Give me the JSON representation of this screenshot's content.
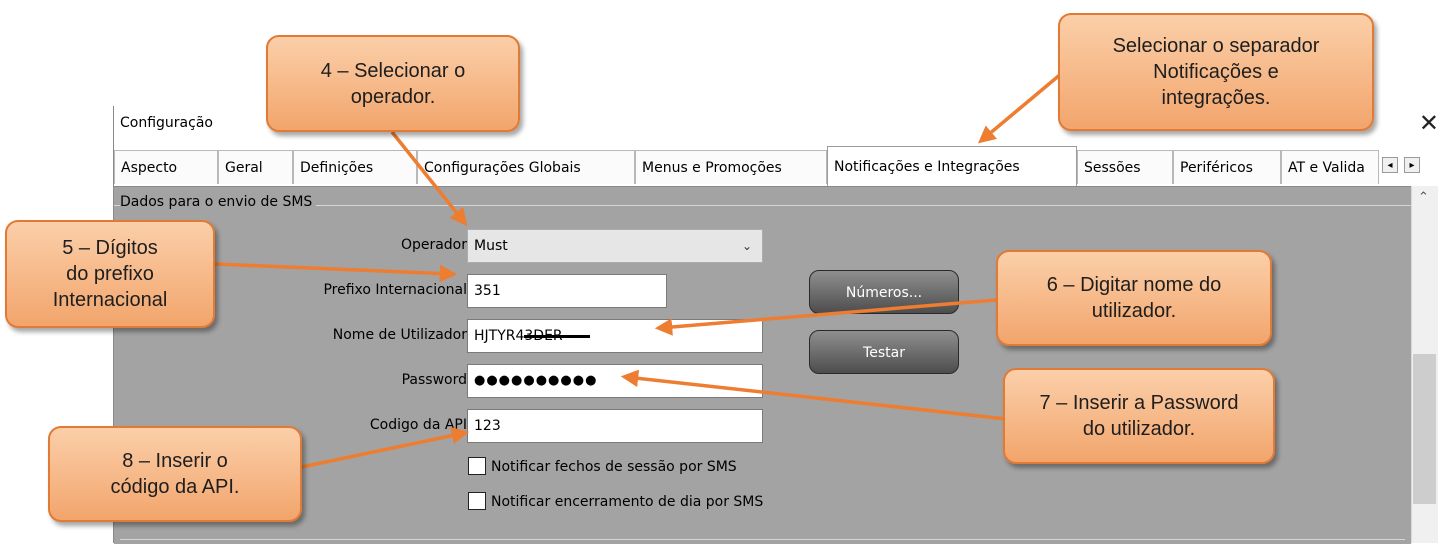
{
  "window": {
    "title": "Configuração",
    "close_glyph": "✕"
  },
  "tabs": [
    {
      "label": "Aspecto"
    },
    {
      "label": "Geral"
    },
    {
      "label": "Definições"
    },
    {
      "label": "Configurações Globais"
    },
    {
      "label": "Menus e Promoções"
    },
    {
      "label": "Notificações e Integrações",
      "active": true
    },
    {
      "label": "Sessões"
    },
    {
      "label": "Periféricos"
    },
    {
      "label": "AT e Valida"
    }
  ],
  "tab_scroll": {
    "left": "◂",
    "right": "▸"
  },
  "group": {
    "title": "Dados para o envio de SMS"
  },
  "form": {
    "operator_label": "Operador",
    "operator_value": "Must",
    "prefix_label": "Prefixo Internacional",
    "prefix_value": "351",
    "username_label": "Nome de Utilizador",
    "username_value": "HJTYR43DER",
    "password_label": "Password",
    "password_value": "●●●●●●●●●●",
    "api_label": "Codigo da API",
    "api_value": "123",
    "notify_session_close": "Notificar fechos de sessão por SMS",
    "notify_day_close": "Notificar encerramento de dia por SMS",
    "notify_session_close_checked": false,
    "notify_day_close_checked": false
  },
  "buttons": {
    "numbers": "Números...",
    "test": "Testar"
  },
  "callouts": {
    "tab": "Selecionar o separador\nNotificações e\nintegrações.",
    "operator": "4 – Selecionar o\noperador.",
    "prefix": "5 – Dígitos\ndo prefixo\nInternacional",
    "username": "6 – Digitar nome do\nutilizador.",
    "password": "7 – Inserir a Password\ndo utilizador.",
    "api": "8 – Inserir o\ncódigo da API."
  },
  "colors": {
    "callout_fill": "#f4b183",
    "callout_border": "#e07a35",
    "arrow": "#ed7d31",
    "panel": "#a3a3a3"
  }
}
